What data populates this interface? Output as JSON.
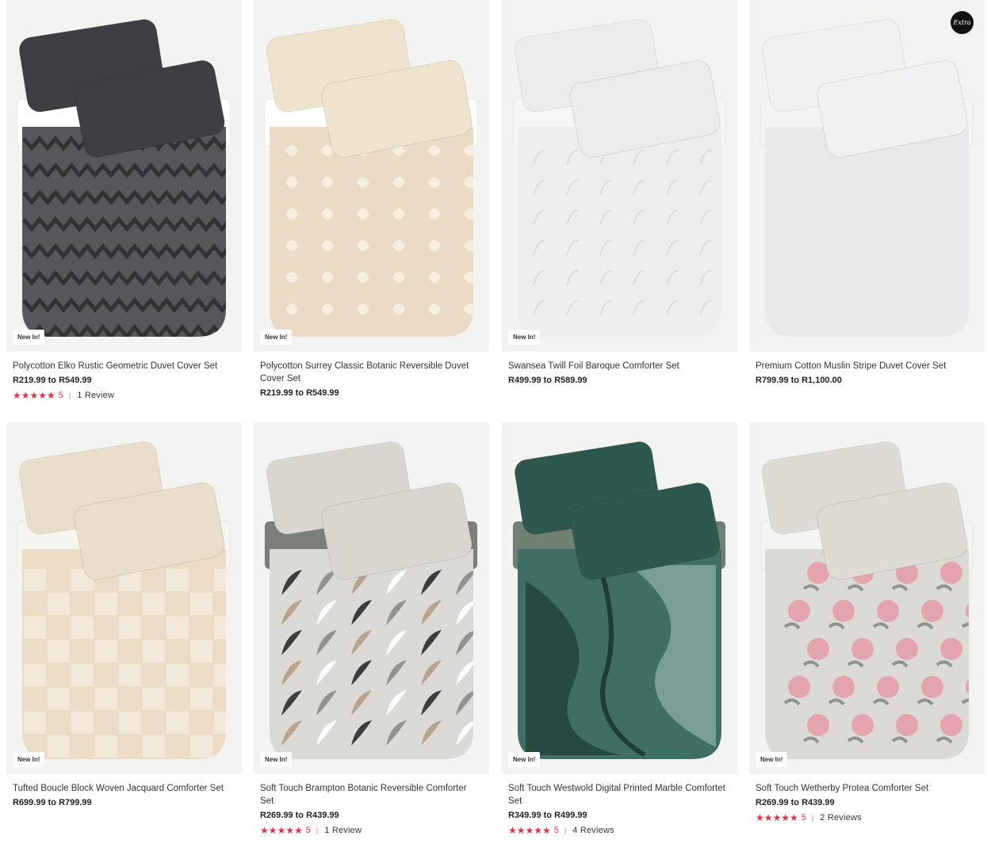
{
  "badge_label": "New In!",
  "extra_logo_text": "Extra",
  "products": [
    {
      "name": "Polycotton Elko Rustic Geometric Duvet Cover Set",
      "price": "R219.99 to R549.99",
      "badge": "New In!",
      "rating": "5",
      "reviews": "1 Review",
      "stars": "★★★★★",
      "colors": {
        "bg": "#f3f3f1",
        "duvet": "#55575b",
        "pattern": "#2a2b2e",
        "sheet": "#ffffff",
        "pillow": "#3d3f43",
        "accent": "#cfd1cc"
      }
    },
    {
      "name": "Polycotton Surrey Classic Botanic Reversible Duvet Cover Set",
      "price": "R219.99 to R549.99",
      "badge": "New In!",
      "rating": "",
      "reviews": "",
      "stars": "",
      "colors": {
        "bg": "#f3f3f1",
        "duvet": "#eadcc4",
        "pattern": "#f7f0e2",
        "sheet": "#ffffff",
        "pillow": "#eee3cd",
        "accent": "#e6eaf0"
      }
    },
    {
      "name": "Swansea Twill Foil Baroque Comforter Set",
      "price": "R499.99 to R589.99",
      "badge": "New In!",
      "rating": "",
      "reviews": "",
      "stars": "",
      "colors": {
        "bg": "#f3f3f1",
        "duvet": "#eeeeec",
        "pattern": "#dcdcd9",
        "sheet": "#f6f6f4",
        "pillow": "#ececea",
        "accent": "#e2e2df"
      }
    },
    {
      "name": "Premium Cotton Muslin Stripe Duvet Cover Set",
      "price": "R799.99 to R1,100.00",
      "badge": "",
      "rating": "",
      "reviews": "",
      "stars": "",
      "colors": {
        "bg": "#f3f3f1",
        "duvet": "#e9e9eb",
        "pattern": "#e4e4e6",
        "sheet": "#f4f4f5",
        "pillow": "#f1f1f3",
        "accent": "#dcdcde"
      }
    },
    {
      "name": "Tufted Boucle Block Woven Jacquard Comforter Set",
      "price": "R699.99 to R799.99",
      "badge": "New In!",
      "rating": "",
      "reviews": "",
      "stars": "",
      "colors": {
        "bg": "#f3f3f1",
        "duvet": "#ebdcc5",
        "pattern": "#f5ecde",
        "sheet": "#f7f5f0",
        "pillow": "#e9decb",
        "accent": "#efe6d6"
      }
    },
    {
      "name": "Soft Touch Brampton Botanic Reversible Comforter Set",
      "price": "R269.99 to R439.99",
      "badge": "New In!",
      "rating": "5",
      "reviews": "1 Review",
      "stars": "★★★★★",
      "colors": {
        "bg": "#f3f3f1",
        "duvet": "#dcdad6",
        "pattern": "#2b2b2b",
        "sheet": "#7b7f78",
        "pillow": "#d9d6d0",
        "accent": "#b59c87"
      }
    },
    {
      "name": "Soft Touch Westwold Digital Printed Marble Comfortet Set",
      "price": "R349.99 to R499.99",
      "badge": "New In!",
      "rating": "5",
      "reviews": "4 Reviews",
      "stars": "★★★★★",
      "colors": {
        "bg": "#f3f3f1",
        "duvet": "#3f6e64",
        "pattern": "#1d3a33",
        "sheet": "#6f8173",
        "pillow": "#2e574e",
        "accent": "#a9c7bd"
      }
    },
    {
      "name": "Soft Touch Wetherby Protea Comforter Set",
      "price": "R269.99 to R439.99",
      "badge": "New In!",
      "rating": "5",
      "reviews": "2 Reviews",
      "stars": "★★★★★",
      "colors": {
        "bg": "#f3f3f1",
        "duvet": "#dcdad5",
        "pattern": "#e59aa8",
        "sheet": "#f4f4f2",
        "pillow": "#dedbd4",
        "accent": "#8d9686"
      }
    }
  ]
}
